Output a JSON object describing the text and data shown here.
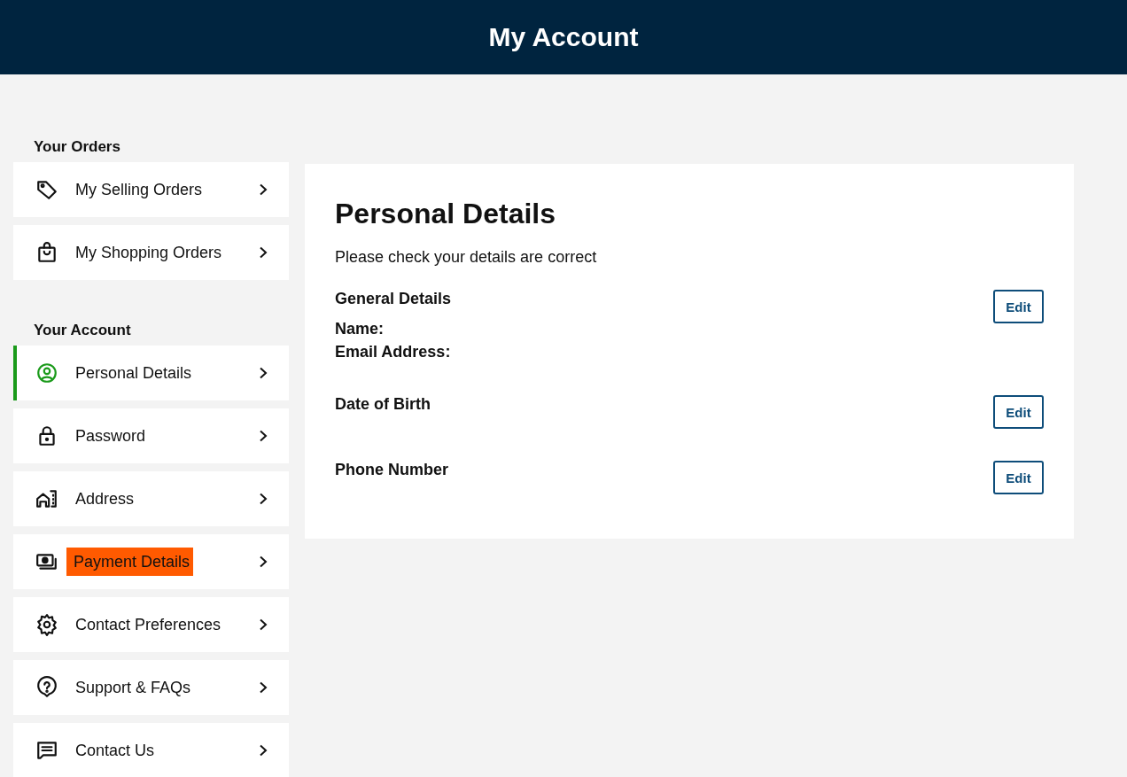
{
  "header": {
    "title": "My Account"
  },
  "sidebar": {
    "sections": [
      {
        "heading": "Your Orders",
        "items": [
          {
            "label": "My Selling Orders",
            "selected": false,
            "highlighted": false
          },
          {
            "label": "My Shopping Orders",
            "selected": false,
            "highlighted": false
          }
        ]
      },
      {
        "heading": "Your Account",
        "items": [
          {
            "label": "Personal Details",
            "selected": true,
            "highlighted": false
          },
          {
            "label": "Password",
            "selected": false,
            "highlighted": false
          },
          {
            "label": "Address",
            "selected": false,
            "highlighted": false
          },
          {
            "label": "Payment Details",
            "selected": false,
            "highlighted": true
          },
          {
            "label": "Contact Preferences",
            "selected": false,
            "highlighted": false
          },
          {
            "label": "Support & FAQs",
            "selected": false,
            "highlighted": false
          },
          {
            "label": "Contact Us",
            "selected": false,
            "highlighted": false
          }
        ]
      }
    ]
  },
  "main": {
    "title": "Personal Details",
    "subtitle": "Please check your details are correct",
    "sections": [
      {
        "heading": "General Details",
        "fields": [
          "Name:",
          "Email Address:"
        ],
        "button": "Edit"
      },
      {
        "heading": "Date of Birth",
        "button": "Edit"
      },
      {
        "heading": "Phone Number",
        "button": "Edit"
      }
    ]
  }
}
